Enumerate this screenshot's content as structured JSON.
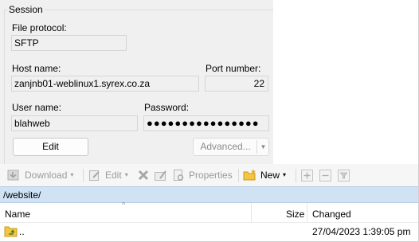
{
  "session": {
    "legend": "Session",
    "file_protocol_label": "File protocol:",
    "file_protocol_value": "SFTP",
    "host_name_label": "Host name:",
    "host_name_value": "zanjnb01-weblinux1.syrex.co.za",
    "port_label": "Port number:",
    "port_value": "22",
    "user_label": "User name:",
    "user_value": "blahweb",
    "password_label": "Password:",
    "password_value": "●●●●●●●●●●●●●●●●",
    "edit_button": "Edit",
    "advanced_button": "Advanced...",
    "advanced_caret": "▼"
  },
  "toolbar": {
    "download": "Download",
    "edit": "Edit",
    "properties": "Properties",
    "new": "New",
    "caret": "▾"
  },
  "path": "/website/",
  "file_list": {
    "columns": {
      "name": "Name",
      "size": "Size",
      "changed": "Changed"
    },
    "sort_indicator": "^",
    "rows": [
      {
        "name": "..",
        "size": "",
        "changed": "27/04/2023 1:39:05 pm"
      }
    ]
  },
  "icons": {
    "download": "download-icon",
    "edit": "edit-icon",
    "delete": "delete-icon",
    "rename": "rename-icon",
    "properties": "properties-icon",
    "new": "new-folder-icon",
    "add": "plus-icon",
    "remove": "minus-icon",
    "filter": "filter-icon",
    "parent": "parent-folder-icon"
  },
  "colors": {
    "panel_bg": "#f0f0f0",
    "path_bar_bg": "#cfe3f5",
    "folder_yellow": "#f4c542",
    "delete_red": "#b0b0b0"
  }
}
